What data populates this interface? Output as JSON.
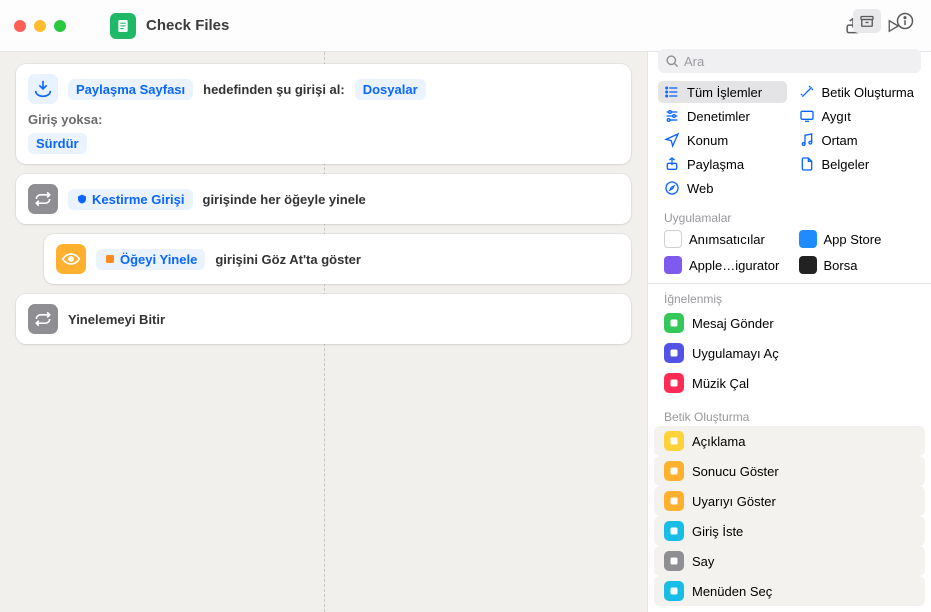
{
  "window": {
    "title": "Check Files"
  },
  "search": {
    "placeholder": "Ara"
  },
  "actions": {
    "receive": {
      "target_token": "Paylaşma Sayfası",
      "middle_text": "hedefinden şu girişi al:",
      "type_token": "Dosyalar",
      "no_input_label": "Giriş yoksa:",
      "no_input_action": "Sürdür"
    },
    "repeat": {
      "input_token": "Kestirme Girişi",
      "text": "girişinde her öğeyle yinele"
    },
    "replace": {
      "input_token": "Öğeyi Yinele",
      "text": "girişini Göz At'ta göster"
    },
    "end_repeat": {
      "text": "Yinelemeyi Bitir"
    }
  },
  "categories": [
    {
      "label": "Tüm İşlemler",
      "icon": "list",
      "color": "#0a66ff",
      "selected": true
    },
    {
      "label": "Betik Oluşturma",
      "icon": "wand",
      "color": "#0a66ff"
    },
    {
      "label": "Denetimler",
      "icon": "sliders",
      "color": "#0a66ff"
    },
    {
      "label": "Aygıt",
      "icon": "device",
      "color": "#0a66ff"
    },
    {
      "label": "Konum",
      "icon": "location",
      "color": "#0a66ff"
    },
    {
      "label": "Ortam",
      "icon": "music-note",
      "color": "#0a66ff"
    },
    {
      "label": "Paylaşma",
      "icon": "share",
      "color": "#0a66ff"
    },
    {
      "label": "Belgeler",
      "icon": "document",
      "color": "#0a66ff"
    },
    {
      "label": "Web",
      "icon": "safari",
      "color": "#0a66ff"
    }
  ],
  "sections": {
    "apps_label": "Uygulamalar",
    "pinned_label": "İğnelenmiş",
    "scripting_label": "Betik Oluşturma"
  },
  "apps": [
    {
      "label": "Anımsatıcılar",
      "color": "#ffffff",
      "border": "#d0d0d0"
    },
    {
      "label": "App Store",
      "color": "#1f8bff"
    },
    {
      "label": "Apple…igurator",
      "color": "#7d5bed"
    },
    {
      "label": "Borsa",
      "color": "#222"
    }
  ],
  "pinned": [
    {
      "label": "Mesaj Gönder",
      "color": "#34c759"
    },
    {
      "label": "Uygulamayı Aç",
      "color": "#5452e5"
    },
    {
      "label": "Müzik Çal",
      "color": "#ff2d55"
    }
  ],
  "scripting": [
    {
      "label": "Açıklama",
      "color": "#ffd23a"
    },
    {
      "label": "Sonucu Göster",
      "color": "#ffb02e"
    },
    {
      "label": "Uyarıyı Göster",
      "color": "#ffb02e"
    },
    {
      "label": "Giriş İste",
      "color": "#18bde5"
    },
    {
      "label": "Say",
      "color": "#8e8e93"
    },
    {
      "label": "Menüden Seç",
      "color": "#18bde5"
    }
  ]
}
